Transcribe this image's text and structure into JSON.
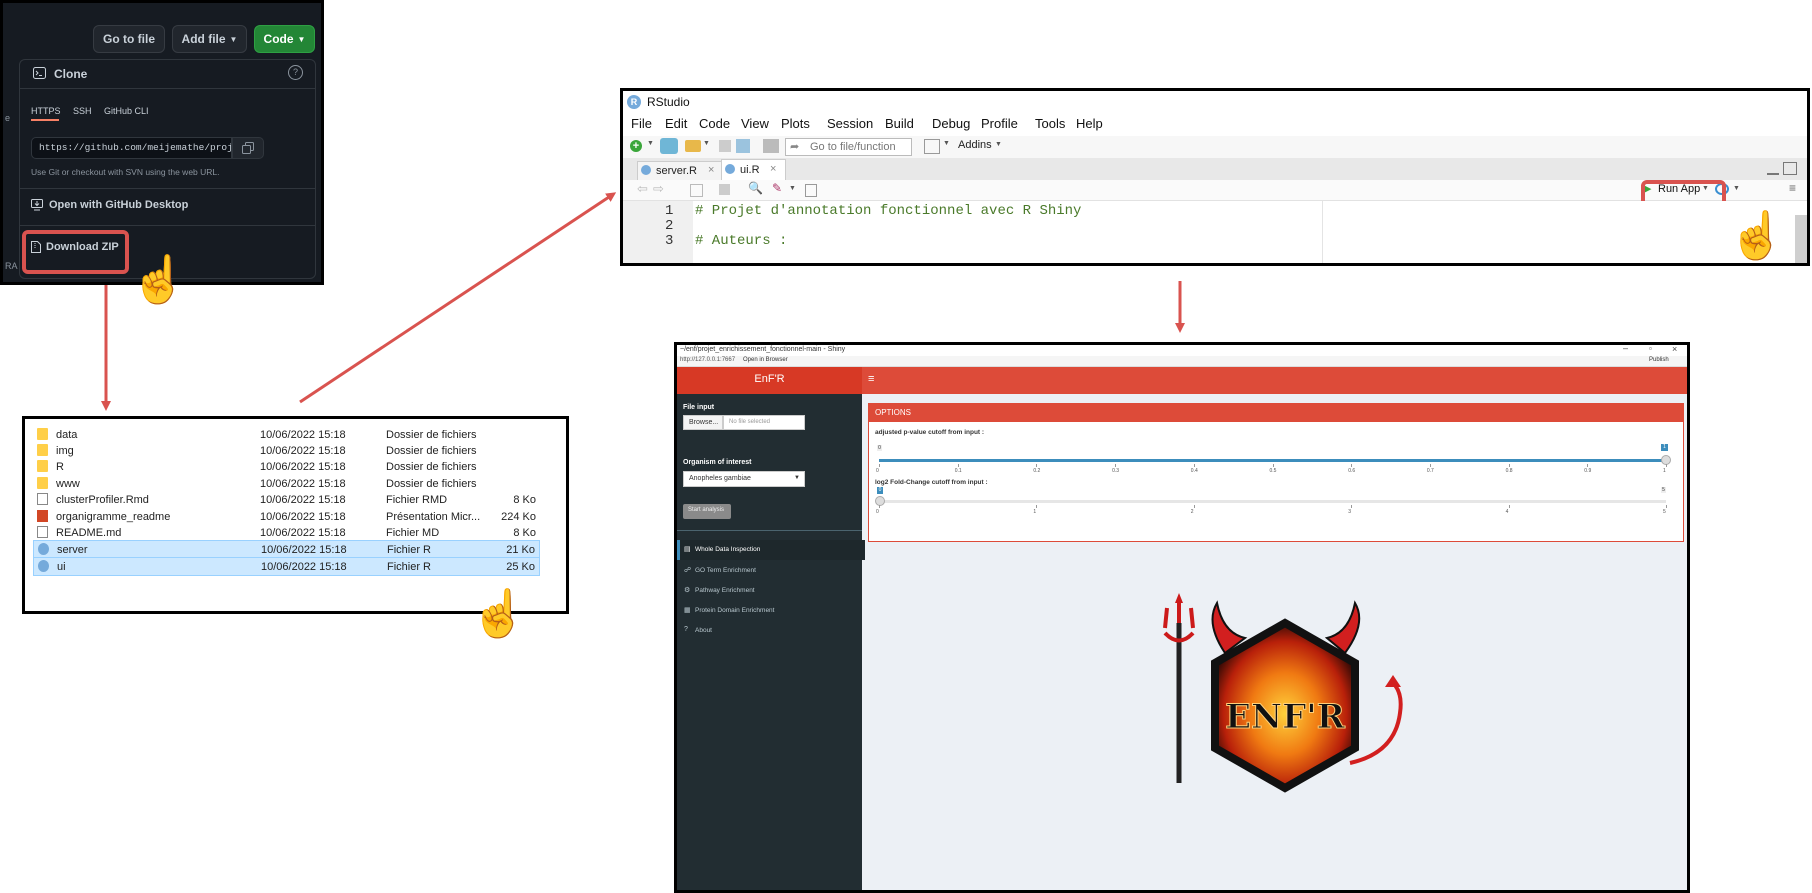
{
  "github": {
    "go_to_file": "Go to file",
    "add_file": "Add file",
    "code": "Code",
    "clone_title": "Clone",
    "tabs": [
      "HTTPS",
      "SSH",
      "GitHub CLI"
    ],
    "url": "https://github.com/meijemathe/projet_enric",
    "hint": "Use Git or checkout with SVN using the web URL.",
    "open_desktop": "Open with GitHub Desktop",
    "download_zip": "Download ZIP",
    "edge_text_1": "e",
    "edge_text_2": "RA"
  },
  "explorer": {
    "rows": [
      {
        "name": "data",
        "date": "10/06/2022 15:18",
        "type": "Dossier de fichiers",
        "size": "",
        "icon": "folder-icon"
      },
      {
        "name": "img",
        "date": "10/06/2022 15:18",
        "type": "Dossier de fichiers",
        "size": "",
        "icon": "folder-icon"
      },
      {
        "name": "R",
        "date": "10/06/2022 15:18",
        "type": "Dossier de fichiers",
        "size": "",
        "icon": "folder-icon"
      },
      {
        "name": "www",
        "date": "10/06/2022 15:18",
        "type": "Dossier de fichiers",
        "size": "",
        "icon": "folder-icon"
      },
      {
        "name": "clusterProfiler.Rmd",
        "date": "10/06/2022 15:18",
        "type": "Fichier RMD",
        "size": "8 Ko",
        "icon": "file-icon"
      },
      {
        "name": "organigramme_readme",
        "date": "10/06/2022 15:18",
        "type": "Présentation Micr...",
        "size": "224 Ko",
        "icon": "powerpoint-icon"
      },
      {
        "name": "README.md",
        "date": "10/06/2022 15:18",
        "type": "Fichier MD",
        "size": "8 Ko",
        "icon": "file-icon"
      },
      {
        "name": "server",
        "date": "10/06/2022 15:18",
        "type": "Fichier R",
        "size": "21 Ko",
        "icon": "r-file-icon"
      },
      {
        "name": "ui",
        "date": "10/06/2022 15:18",
        "type": "Fichier R",
        "size": "25 Ko",
        "icon": "r-file-icon"
      }
    ]
  },
  "rstudio": {
    "title": "RStudio",
    "menu": [
      "File",
      "Edit",
      "Code",
      "View",
      "Plots",
      "Session",
      "Build",
      "Debug",
      "Profile",
      "Tools",
      "Help"
    ],
    "go_to_placeholder": "Go to file/function",
    "addins": "Addins",
    "tabs": [
      "server.R",
      "ui.R"
    ],
    "run_app": "Run App",
    "line_numbers": [
      "1",
      "2",
      "3"
    ],
    "code_line_1": "# Projet d'annotation fonctionnel avec R Shiny",
    "code_line_3": "# Auteurs :"
  },
  "shiny": {
    "window_title": "~/enf/projet_enrichissement_fonctionnel-main - Shiny",
    "address": "http://127.0.0.1:7667",
    "open_browser": "Open in Browser",
    "publish": "Publish",
    "brand": "EnF'R",
    "file_input_label": "File input",
    "browse": "Browse...",
    "no_file": "No file selected",
    "organism_label": "Organism of interest",
    "organism_value": "Anopheles gambiae",
    "start_analysis": "Start analysis",
    "nav": [
      "Whole Data Inspection",
      "GO Term Enrichment",
      "Pathway Enrichment",
      "Protein Domain Enrichment",
      "About"
    ],
    "options_title": "OPTIONS",
    "pval_label": "adjusted p-value cutoff from input :",
    "pval_ticks": [
      "0",
      "0.1",
      "0.2",
      "0.3",
      "0.4",
      "0.5",
      "0.6",
      "0.7",
      "0.8",
      "0.9",
      "1"
    ],
    "pval_min": "0",
    "pval_max": "1",
    "fc_label": "log2 Fold-Change cutoff from input :",
    "fc_ticks": [
      "0",
      "1",
      "2",
      "3",
      "4",
      "5"
    ],
    "fc_min": "0",
    "fc_max": "5",
    "logo_text": "ENF'R"
  },
  "colors": {
    "github_green": "#238636",
    "highlight_red": "#d9534f",
    "arrow_red": "#d9534f",
    "shiny_header": "#dd4b39",
    "shiny_sidebar": "#222d32",
    "slider_blue": "#3c8dbc"
  }
}
